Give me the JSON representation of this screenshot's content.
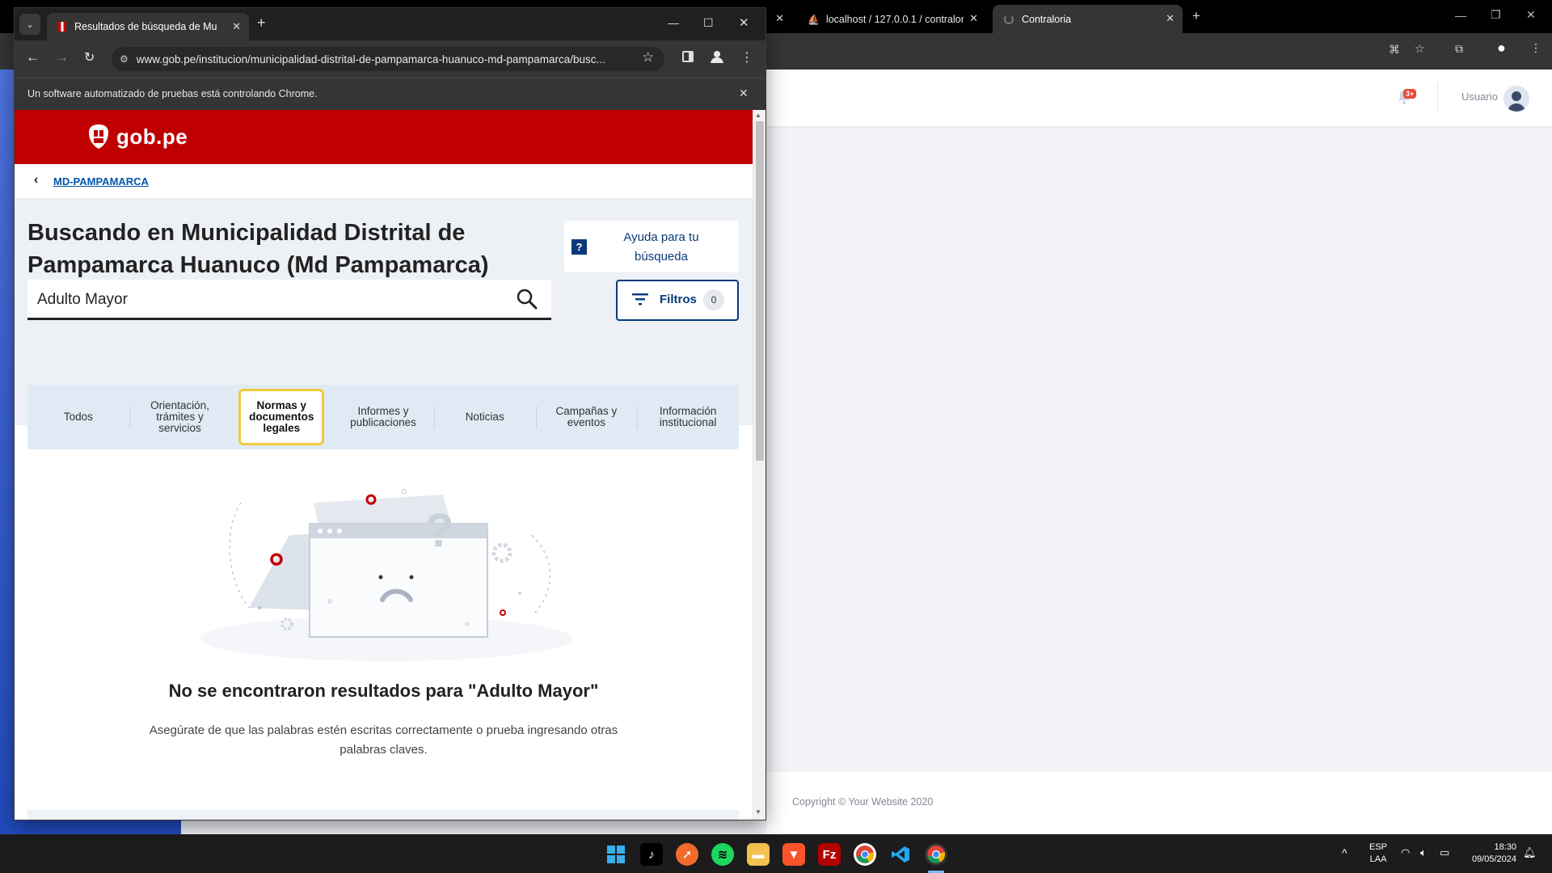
{
  "background_browser": {
    "tabs": [
      {
        "label": "localhost / 127.0.0.1 / contralor"
      },
      {
        "label": "Contraloria"
      }
    ],
    "header": {
      "user_label": "Usuario",
      "notification_badge": "3+"
    },
    "footer": {
      "copyright": "Copyright © Your Website 2020"
    }
  },
  "browser": {
    "tab_title": "Resultados de búsqueda de Mu",
    "new_tab": "+",
    "url": "www.gob.pe/institucion/municipalidad-distrital-de-pampamarca-huanuco-md-pampamarca/busc...",
    "automation_notice": "Un software automatizado de pruebas está controlando Chrome."
  },
  "page": {
    "logo_text": "gob.pe",
    "breadcrumb": "MD-PAMPAMARCA",
    "title_line1": "Buscando en Municipalidad Distrital de",
    "title_line2": "Pampamarca Huanuco (Md Pampamarca)",
    "help_label_line1": "Ayuda para tu",
    "help_label_line2": "búsqueda",
    "help_icon": "?",
    "search": {
      "value": "Adulto Mayor",
      "placeholder": ""
    },
    "filters_label": "Filtros",
    "filters_count": "0",
    "categories": [
      {
        "label_lines": [
          "Todos"
        ],
        "active": false
      },
      {
        "label_lines": [
          "Orientación,",
          "trámites y",
          "servicios"
        ],
        "active": false
      },
      {
        "label_lines": [
          "Normas y",
          "documentos",
          "legales"
        ],
        "active": true
      },
      {
        "label_lines": [
          "Informes y",
          "publicaciones"
        ],
        "active": false
      },
      {
        "label_lines": [
          "Noticias"
        ],
        "active": false
      },
      {
        "label_lines": [
          "Campañas y",
          "eventos"
        ],
        "active": false
      },
      {
        "label_lines": [
          "Información",
          "institucional"
        ],
        "active": false
      }
    ],
    "empty_title": "No se encontraron resultados para \"Adulto Mayor\"",
    "empty_message_line1": "Asegúrate de que las palabras estén escritas correctamente o prueba ingresando otras",
    "empty_message_line2": "palabras claves."
  },
  "taskbar": {
    "language_line1": "ESP",
    "language_line2": "LAA",
    "time": "18:30",
    "date": "09/05/2024"
  },
  "colors": {
    "gob_red": "#c00000",
    "link_blue": "#0056ac",
    "active_tab_border": "#f3c93a",
    "filter_blue": "#003b7a"
  }
}
